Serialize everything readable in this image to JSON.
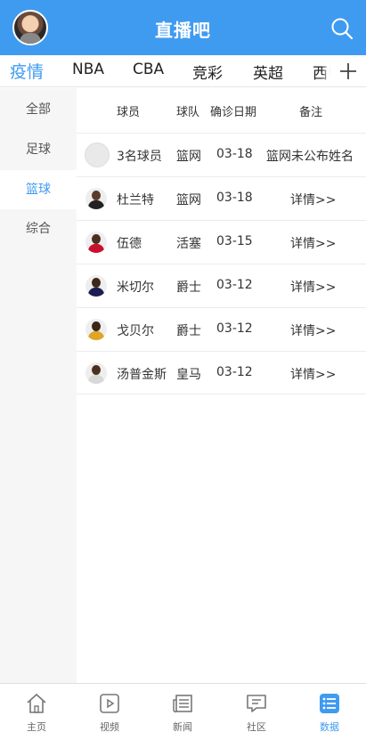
{
  "header": {
    "title": "直播吧"
  },
  "tabs": [
    "疫情",
    "NBA",
    "CBA",
    "竞彩",
    "英超",
    "西甲"
  ],
  "sidebar": [
    "全部",
    "足球",
    "篮球",
    "综合"
  ],
  "table": {
    "headers": {
      "player": "球员",
      "team": "球队",
      "date": "确诊日期",
      "note": "备注"
    },
    "rows": [
      {
        "player": "3名球员",
        "team": "篮网",
        "date": "03-18",
        "note": "篮网未公布姓名"
      },
      {
        "player": "杜兰特",
        "team": "篮网",
        "date": "03-18",
        "note": "详情>>"
      },
      {
        "player": "伍德",
        "team": "活塞",
        "date": "03-15",
        "note": "详情>>"
      },
      {
        "player": "米切尔",
        "team": "爵士",
        "date": "03-12",
        "note": "详情>>"
      },
      {
        "player": "戈贝尔",
        "team": "爵士",
        "date": "03-12",
        "note": "详情>>"
      },
      {
        "player": "汤普金斯",
        "team": "皇马",
        "date": "03-12",
        "note": "详情>>"
      }
    ]
  },
  "bottom_nav": [
    "主页",
    "视频",
    "新闻",
    "社区",
    "数据"
  ],
  "colors": {
    "accent": "#3f9bf0",
    "sidebar_bg": "#f6f6f6"
  }
}
